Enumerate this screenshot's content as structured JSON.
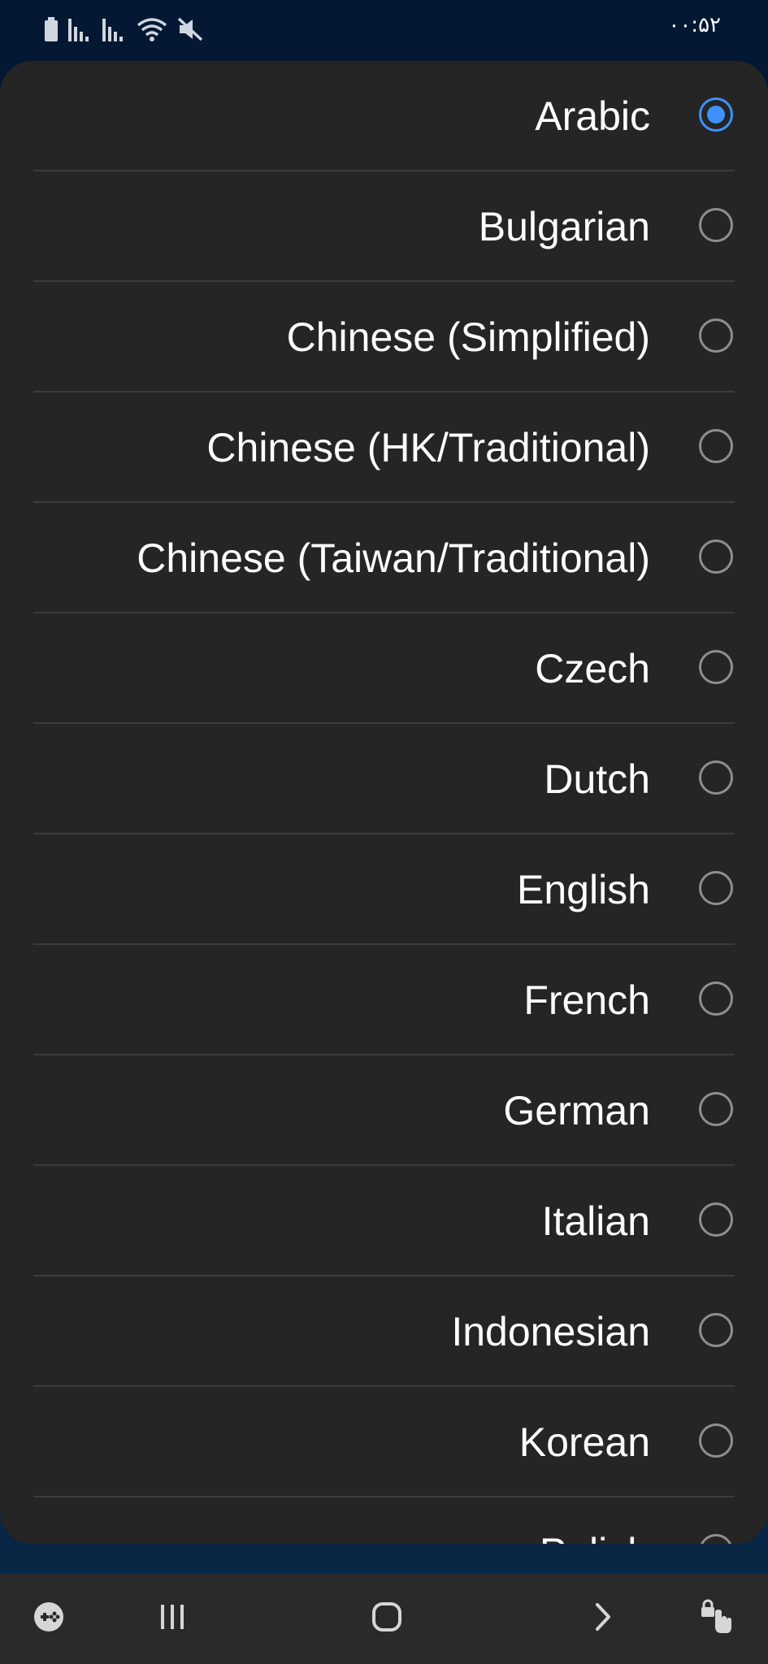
{
  "status_bar": {
    "time": "۰۰:۵۲",
    "icons": [
      "battery-icon",
      "signal-icon",
      "signal-icon",
      "wifi-icon",
      "mute-icon"
    ]
  },
  "language_list": {
    "selected_index": 0,
    "accent_color": "#3e91ff",
    "items": [
      {
        "label": "Arabic",
        "selected": true
      },
      {
        "label": "Bulgarian",
        "selected": false
      },
      {
        "label": "Chinese (Simplified)",
        "selected": false
      },
      {
        "label": "Chinese (HK/Traditional)",
        "selected": false
      },
      {
        "label": "Chinese (Taiwan/Traditional)",
        "selected": false
      },
      {
        "label": "Czech",
        "selected": false
      },
      {
        "label": "Dutch",
        "selected": false
      },
      {
        "label": "English",
        "selected": false
      },
      {
        "label": "French",
        "selected": false
      },
      {
        "label": "German",
        "selected": false
      },
      {
        "label": "Italian",
        "selected": false
      },
      {
        "label": "Indonesian",
        "selected": false
      },
      {
        "label": "Korean",
        "selected": false
      },
      {
        "label": "Polish",
        "selected": false
      }
    ]
  },
  "nav_bar": {
    "buttons": [
      "game-launcher-icon",
      "recent-apps-icon",
      "home-icon",
      "forward-icon",
      "touch-lock-icon"
    ]
  }
}
